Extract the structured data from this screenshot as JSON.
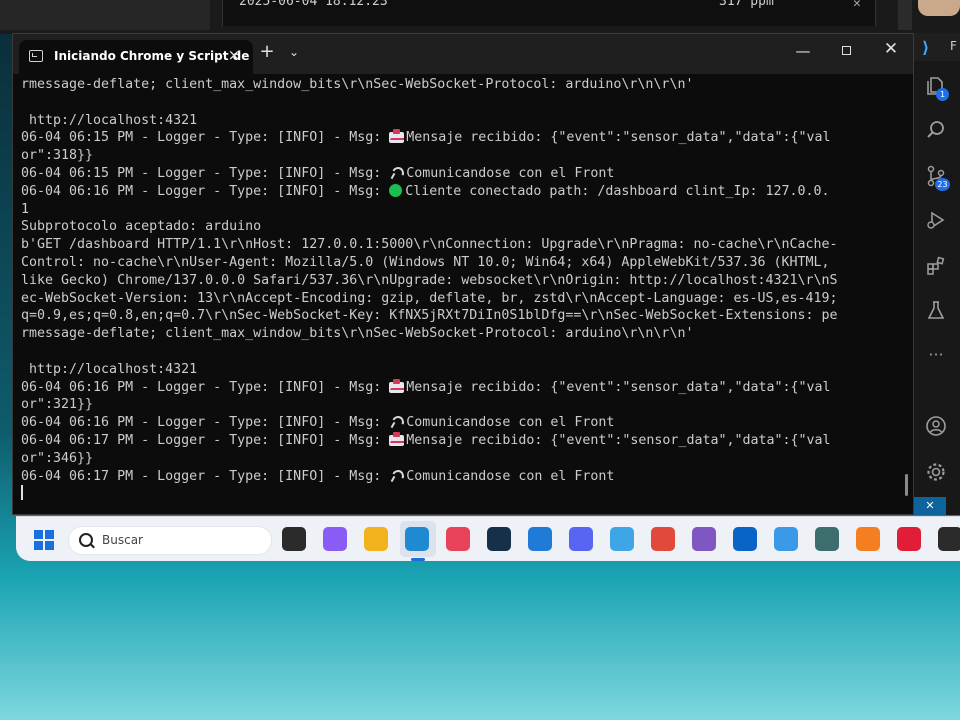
{
  "background_window": {
    "text_left": "2025-06-04 18:12:23",
    "text_right": "317 ppm"
  },
  "terminal": {
    "tab_title": "Iniciando Chrome y Script de",
    "close_tab_glyph": "×",
    "new_tab_glyph": "+",
    "dropdown_glyph": "⌄",
    "minimize_glyph": "—",
    "close_glyph": "✕"
  },
  "console_lines": [
    {
      "text": "rmessage-deflate; client_max_window_bits\\r\\nSec-WebSocket-Protocol: arduino\\r\\n\\r\\n'"
    },
    {
      "text": ""
    },
    {
      "text": " http://localhost:4321"
    },
    {
      "prefix": "06-04 06:15 PM - Logger - Type: [INFO] - Msg: ",
      "icon": "mail-icon",
      "text": "Mensaje recibido: {\"event\":\"sensor_data\",\"data\":{\"val"
    },
    {
      "text": "or\":318}}"
    },
    {
      "prefix": "06-04 06:15 PM - Logger - Type: [INFO] - Msg: ",
      "icon": "satellite-icon",
      "text": "Comunicandose con el Front"
    },
    {
      "prefix": "06-04 06:16 PM - Logger - Type: [INFO] - Msg: ",
      "icon": "green-circle-icon",
      "text": "Cliente conectado path: /dashboard clint_Ip: 127.0.0."
    },
    {
      "text": "1"
    },
    {
      "text": "Subprotocolo aceptado: arduino"
    },
    {
      "text": "b'GET /dashboard HTTP/1.1\\r\\nHost: 127.0.0.1:5000\\r\\nConnection: Upgrade\\r\\nPragma: no-cache\\r\\nCache-"
    },
    {
      "text": "Control: no-cache\\r\\nUser-Agent: Mozilla/5.0 (Windows NT 10.0; Win64; x64) AppleWebKit/537.36 (KHTML,"
    },
    {
      "text": "like Gecko) Chrome/137.0.0.0 Safari/537.36\\r\\nUpgrade: websocket\\r\\nOrigin: http://localhost:4321\\r\\nS"
    },
    {
      "text": "ec-WebSocket-Version: 13\\r\\nAccept-Encoding: gzip, deflate, br, zstd\\r\\nAccept-Language: es-US,es-419;"
    },
    {
      "text": "q=0.9,es;q=0.8,en;q=0.7\\r\\nSec-WebSocket-Key: KfNX5jRXt7DiIn0S1blDfg==\\r\\nSec-WebSocket-Extensions: pe"
    },
    {
      "text": "rmessage-deflate; client_max_window_bits\\r\\nSec-WebSocket-Protocol: arduino\\r\\n\\r\\n'"
    },
    {
      "text": ""
    },
    {
      "text": " http://localhost:4321"
    },
    {
      "prefix": "06-04 06:16 PM - Logger - Type: [INFO] - Msg: ",
      "icon": "mail-icon",
      "text": "Mensaje recibido: {\"event\":\"sensor_data\",\"data\":{\"val"
    },
    {
      "text": "or\":321}}"
    },
    {
      "prefix": "06-04 06:16 PM - Logger - Type: [INFO] - Msg: ",
      "icon": "satellite-icon",
      "text": "Comunicandose con el Front"
    },
    {
      "prefix": "06-04 06:17 PM - Logger - Type: [INFO] - Msg: ",
      "icon": "mail-icon",
      "text": "Mensaje recibido: {\"event\":\"sensor_data\",\"data\":{\"val"
    },
    {
      "text": "or\":346}}"
    },
    {
      "prefix": "06-04 06:17 PM - Logger - Type: [INFO] - Msg: ",
      "icon": "satellite-icon",
      "text": "Comunicandose con el Front"
    },
    {
      "text": "",
      "cursor": true
    }
  ],
  "vscode": {
    "logo_glyph": "⟩",
    "title_letter": "F",
    "explorer_badge": "1",
    "scm_badge": "23",
    "activity_icons": [
      "files-icon",
      "search-icon",
      "source-control-icon",
      "run-debug-icon",
      "extensions-icon",
      "testing-icon",
      "more-icon",
      "account-icon",
      "settings-icon"
    ],
    "remote_glyph": "✕",
    "accent": "#0e639c"
  },
  "taskbar": {
    "search_placeholder": "Buscar",
    "apps": [
      {
        "name": "task-view-icon",
        "color": "#2b2b2b"
      },
      {
        "name": "copilot-icon",
        "color": "#8a5cf6"
      },
      {
        "name": "file-explorer-icon",
        "color": "#f2b21c"
      },
      {
        "name": "vscode-icon",
        "color": "#1f8ad2"
      },
      {
        "name": "app-red-icon",
        "color": "#e8435a"
      },
      {
        "name": "steam-icon",
        "color": "#16304a"
      },
      {
        "name": "mail-app-icon",
        "color": "#1f7ad8"
      },
      {
        "name": "discord-icon",
        "color": "#5865f2"
      },
      {
        "name": "settings-app-icon",
        "color": "#3ea6e6"
      },
      {
        "name": "chrome-icon",
        "color": "#e0493b"
      },
      {
        "name": "visual-studio-icon",
        "color": "#7e57c2"
      },
      {
        "name": "outlook-icon",
        "color": "#0a64c8"
      },
      {
        "name": "music-icon",
        "color": "#3a9ae8"
      },
      {
        "name": "desktop-app-icon",
        "color": "#3c6e6e"
      },
      {
        "name": "orange-app-icon",
        "color": "#f57f20"
      },
      {
        "name": "opera-icon",
        "color": "#e01e37"
      },
      {
        "name": "obs-icon",
        "color": "#2b2b2b"
      }
    ]
  }
}
